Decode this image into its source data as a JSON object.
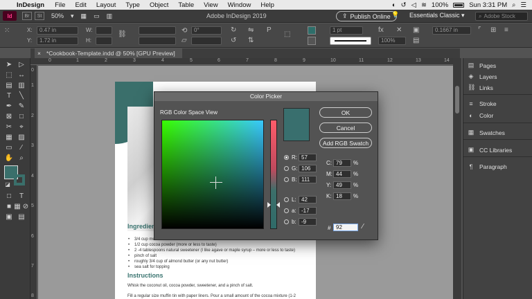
{
  "menubar": {
    "app_name": "InDesign",
    "items": [
      "File",
      "Edit",
      "Layout",
      "Type",
      "Object",
      "Table",
      "View",
      "Window",
      "Help"
    ],
    "battery": "100%",
    "clock": "Sun 3:31 PM"
  },
  "appbar": {
    "logo_text": "Id",
    "bridge": "Br",
    "stock_btn": "St",
    "zoom_value": "50%",
    "title": "Adobe InDesign 2019",
    "publish_label": "Publish Online",
    "workspace_label": "Essentials Classic",
    "stock_placeholder": "Adobe Stock"
  },
  "controlbar": {
    "x_label": "X:",
    "x_value": "0.47 in",
    "y_label": "Y:",
    "y_value": "1.72 in",
    "w_label": "W:",
    "h_label": "H:",
    "angle_value": "0°",
    "stroke_weight": "1 pt",
    "opacity": "100%",
    "dimension_value": "0.1667 in"
  },
  "doctab": {
    "close": "×",
    "label": "*Cookbook-Template.indd @ 50% [GPU Preview]"
  },
  "ruler": {
    "top": [
      "0",
      "1",
      "2",
      "3",
      "4",
      "5",
      "6",
      "7",
      "8",
      "9",
      "10",
      "11",
      "12",
      "13",
      "14"
    ],
    "left": [
      "0",
      "1",
      "2",
      "3",
      "4",
      "5",
      "6",
      "7",
      "8"
    ]
  },
  "page": {
    "ingredients_title": "Ingredients",
    "ingredients": [
      "3/4 cup melted coconut oil",
      "1/2 cup cocoa powder (more or less to taste)",
      "2 -4 tablespoons natural sweetener (I like agave or maple syrup – more or less to taste)",
      "pinch of salt",
      "roughly 3/4 cup of almond butter (or any nut butter)",
      "sea salt for topping"
    ],
    "instructions_title": "Instructions",
    "instructions": [
      "Whisk the coconut oil, cocoa powder, sweetener, and a pinch of salt.",
      "Fill a regular size muffin tin with paper liners. Pour a small amount of the cocoa mixture (1-2"
    ]
  },
  "panels": {
    "items": [
      {
        "label": "Pages",
        "icon": "pages-icon"
      },
      {
        "label": "Layers",
        "icon": "layers-icon"
      },
      {
        "label": "Links",
        "icon": "links-icon"
      },
      {
        "label": "Stroke",
        "icon": "stroke-icon"
      },
      {
        "label": "Color",
        "icon": "color-icon"
      },
      {
        "label": "Swatches",
        "icon": "swatches-icon"
      },
      {
        "label": "CC Libraries",
        "icon": "cc-libraries-icon"
      },
      {
        "label": "Paragraph",
        "icon": "paragraph-icon"
      }
    ]
  },
  "picker": {
    "title": "Color Picker",
    "subtitle": "RGB Color Space View",
    "ok_label": "OK",
    "cancel_label": "Cancel",
    "add_swatch_label": "Add RGB Swatch",
    "r_label": "R:",
    "r_value": "57",
    "g_label": "G:",
    "g_value": "106",
    "b_label": "B:",
    "b_value": "111",
    "l_label": "L:",
    "l_value": "42",
    "a_label": "a:",
    "a_value": "-17",
    "bb_label": "b:",
    "bb_value": "-9",
    "c_label": "C:",
    "c_value": "79",
    "m_label": "M:",
    "m_value": "44",
    "y_label": "Y:",
    "y_value": "49",
    "k_label": "K:",
    "k_value": "18",
    "percent": "%",
    "hex_label": "#",
    "hex_value": "92",
    "preview_color": "#396f6e"
  },
  "colors": {
    "accent_teal": "#3a6f6b",
    "panel_bg": "#424242",
    "dialog_bg": "#535353"
  }
}
